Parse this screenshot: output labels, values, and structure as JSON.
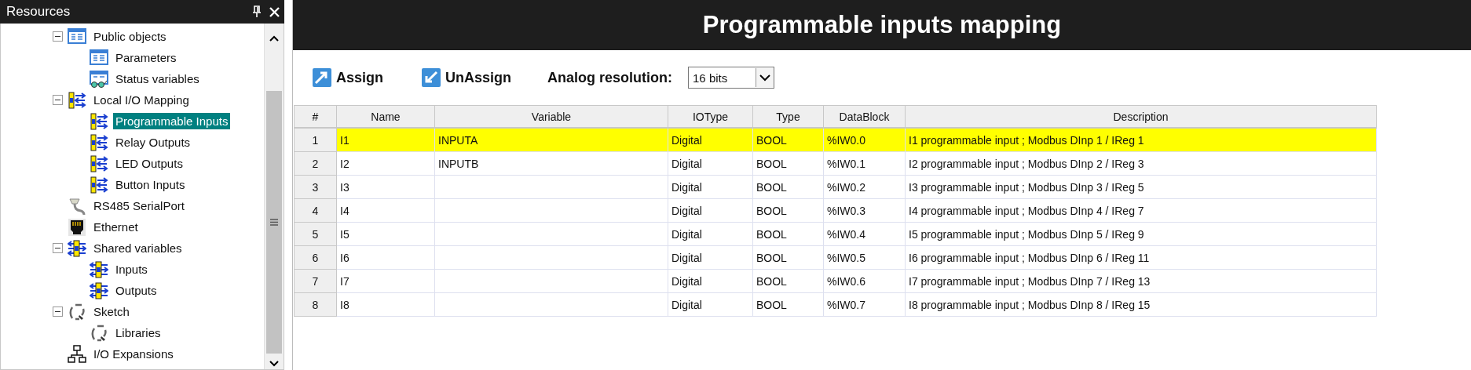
{
  "resources_panel": {
    "title": "Resources",
    "tree": [
      {
        "label": "Public objects",
        "kind": "list",
        "selected": false,
        "expanded": true,
        "children": [
          {
            "label": "Parameters",
            "kind": "list",
            "selected": false
          },
          {
            "label": "Status variables",
            "kind": "watch",
            "selected": false
          }
        ]
      },
      {
        "label": "Local I/O Mapping",
        "kind": "io",
        "selected": false,
        "expanded": true,
        "children": [
          {
            "label": "Programmable Inputs",
            "kind": "io",
            "selected": true
          },
          {
            "label": "Relay Outputs",
            "kind": "io",
            "selected": false
          },
          {
            "label": "LED Outputs",
            "kind": "io",
            "selected": false
          },
          {
            "label": "Button Inputs",
            "kind": "io",
            "selected": false
          }
        ]
      },
      {
        "label": "RS485 SerialPort",
        "kind": "serial",
        "selected": false
      },
      {
        "label": "Ethernet",
        "kind": "ethernet",
        "selected": false
      },
      {
        "label": "Shared variables",
        "kind": "shared",
        "selected": false,
        "expanded": true,
        "children": [
          {
            "label": "Inputs",
            "kind": "shared",
            "selected": false
          },
          {
            "label": "Outputs",
            "kind": "shared",
            "selected": false
          }
        ]
      },
      {
        "label": "Sketch",
        "kind": "sketch",
        "selected": false,
        "expanded": true,
        "children": [
          {
            "label": "Libraries",
            "kind": "sketch",
            "selected": false
          }
        ]
      },
      {
        "label": "I/O Expansions",
        "kind": "network",
        "selected": false
      }
    ]
  },
  "mapping_panel": {
    "title": "Programmable inputs mapping",
    "toolbar": {
      "assign": "Assign",
      "unassign": "UnAssign",
      "resolution_label": "Analog resolution:",
      "resolution_value": "16 bits"
    },
    "table": {
      "columns": [
        "#",
        "Name",
        "Variable",
        "IOType",
        "Type",
        "DataBlock",
        "Description"
      ],
      "rows": [
        {
          "selected": true,
          "cells": [
            "1",
            "I1",
            "INPUTA",
            "Digital",
            "BOOL",
            "%IW0.0",
            "I1 programmable input ; Modbus DInp 1 / IReg 1"
          ]
        },
        {
          "selected": false,
          "cells": [
            "2",
            "I2",
            "INPUTB",
            "Digital",
            "BOOL",
            "%IW0.1",
            "I2 programmable input ; Modbus DInp 2 / IReg 3"
          ]
        },
        {
          "selected": false,
          "cells": [
            "3",
            "I3",
            "",
            "Digital",
            "BOOL",
            "%IW0.2",
            "I3 programmable input ; Modbus DInp 3 / IReg 5"
          ]
        },
        {
          "selected": false,
          "cells": [
            "4",
            "I4",
            "",
            "Digital",
            "BOOL",
            "%IW0.3",
            "I4 programmable input ; Modbus DInp 4 / IReg 7"
          ]
        },
        {
          "selected": false,
          "cells": [
            "5",
            "I5",
            "",
            "Digital",
            "BOOL",
            "%IW0.4",
            "I5 programmable input ; Modbus DInp 5 / IReg 9"
          ]
        },
        {
          "selected": false,
          "cells": [
            "6",
            "I6",
            "",
            "Digital",
            "BOOL",
            "%IW0.5",
            "I6 programmable input ; Modbus DInp 6 / IReg 11"
          ]
        },
        {
          "selected": false,
          "cells": [
            "7",
            "I7",
            "",
            "Digital",
            "BOOL",
            "%IW0.6",
            "I7 programmable input ; Modbus DInp 7 / IReg 13"
          ]
        },
        {
          "selected": false,
          "cells": [
            "8",
            "I8",
            "",
            "Digital",
            "BOOL",
            "%IW0.7",
            "I8 programmable input ; Modbus DInp 8 / IReg 15"
          ]
        }
      ]
    }
  }
}
